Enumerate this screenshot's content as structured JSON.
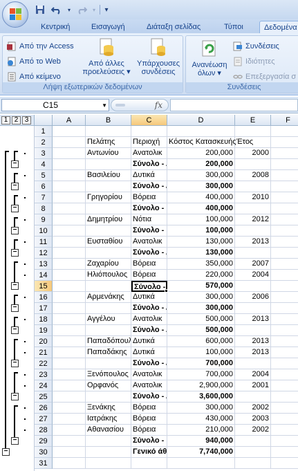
{
  "qat": {
    "save": "save-icon",
    "undo": "undo-icon",
    "redo": "redo-icon",
    "customize": "▾"
  },
  "tabs": [
    "Κεντρική",
    "Εισαγωγή",
    "Διάταξη σελίδας",
    "Τύποι",
    "Δεδομένα"
  ],
  "ribbon": {
    "external": {
      "access": "Από την Access",
      "web": "Από το Web",
      "text": "Από κείμενο",
      "other_line1": "Από άλλες",
      "other_line2": "προελεύσεις ▾",
      "existing_line1": "Υπάρχουσες",
      "existing_line2": "συνδέσεις",
      "label": "Λήψη εξωτερικών δεδομένων"
    },
    "connections": {
      "refresh_line1": "Ανανέωση",
      "refresh_line2": "όλων ▾",
      "conn": "Συνδέσεις",
      "props": "Ιδιότητες",
      "edit": "Επεξεργασία σ",
      "label": "Συνδέσεις"
    }
  },
  "formula_bar": {
    "name_box": "C15",
    "fx": "fx",
    "formula": ""
  },
  "outline_levels": [
    "1",
    "2",
    "3"
  ],
  "columns": [
    "A",
    "B",
    "C",
    "D",
    "E",
    "F"
  ],
  "rows": [
    {
      "n": "1",
      "b": "",
      "c": "",
      "d": "",
      "e": "",
      "bold": false
    },
    {
      "n": "2",
      "b": "Πελάτης",
      "c": "Περιοχή",
      "d": "Κόστος Κατασκευής",
      "e": "Έτος",
      "bold": false,
      "header": true
    },
    {
      "n": "3",
      "b": "Αντωνίου",
      "c": "Ανατολικ",
      "d": "200,000",
      "e": "2000",
      "bold": false
    },
    {
      "n": "4",
      "b": "",
      "c": "Σύνολο - Α",
      "d": "200,000",
      "e": "",
      "bold": true
    },
    {
      "n": "5",
      "b": "Βασιλείου",
      "c": "Δυτικά",
      "d": "300,000",
      "e": "2008",
      "bold": false
    },
    {
      "n": "6",
      "b": "",
      "c": "Σύνολο - Δ",
      "d": "300,000",
      "e": "",
      "bold": true
    },
    {
      "n": "7",
      "b": "Γρηγορίου",
      "c": "Βόρεια",
      "d": "400,000",
      "e": "2010",
      "bold": false
    },
    {
      "n": "8",
      "b": "",
      "c": "Σύνολο - Β",
      "d": "400,000",
      "e": "",
      "bold": true
    },
    {
      "n": "9",
      "b": "Δημητρίου",
      "c": "Νότια",
      "d": "100,000",
      "e": "2012",
      "bold": false
    },
    {
      "n": "10",
      "b": "",
      "c": "Σύνολο - Ν",
      "d": "100,000",
      "e": "",
      "bold": true
    },
    {
      "n": "11",
      "b": "Ευσταθίου",
      "c": "Ανατολικ",
      "d": "130,000",
      "e": "2013",
      "bold": false
    },
    {
      "n": "12",
      "b": "",
      "c": "Σύνολο - Α",
      "d": "130,000",
      "e": "",
      "bold": true
    },
    {
      "n": "13",
      "b": "Ζαχαρίου",
      "c": "Βόρεια",
      "d": "350,000",
      "e": "2007",
      "bold": false
    },
    {
      "n": "14",
      "b": "Ηλιόπουλος",
      "c": "Βόρεια",
      "d": "220,000",
      "e": "2004",
      "bold": false
    },
    {
      "n": "15",
      "b": "",
      "c": "Σύνολο - Β",
      "d": "570,000",
      "e": "",
      "bold": true
    },
    {
      "n": "16",
      "b": "Αρμενάκης",
      "c": "Δυτικά",
      "d": "300,000",
      "e": "2006",
      "bold": false
    },
    {
      "n": "17",
      "b": "",
      "c": "Σύνολο - Δ",
      "d": "300,000",
      "e": "",
      "bold": true
    },
    {
      "n": "18",
      "b": "Αγγέλου",
      "c": "Ανατολικ",
      "d": "500,000",
      "e": "2013",
      "bold": false
    },
    {
      "n": "19",
      "b": "",
      "c": "Σύνολο - Α",
      "d": "500,000",
      "e": "",
      "bold": true
    },
    {
      "n": "20",
      "b": "Παπαδόπουλ",
      "c": "Δυτικά",
      "d": "600,000",
      "e": "2013",
      "bold": false
    },
    {
      "n": "21",
      "b": "Παπαδάκης",
      "c": "Δυτικά",
      "d": "100,000",
      "e": "2013",
      "bold": false
    },
    {
      "n": "22",
      "b": "",
      "c": "Σύνολο - Δ",
      "d": "700,000",
      "e": "",
      "bold": true
    },
    {
      "n": "23",
      "b": "Ξενόπουλος",
      "c": "Ανατολικ",
      "d": "700,000",
      "e": "2004",
      "bold": false
    },
    {
      "n": "24",
      "b": "Ορφανός",
      "c": "Ανατολικ",
      "d": "2,900,000",
      "e": "2001",
      "bold": false
    },
    {
      "n": "25",
      "b": "",
      "c": "Σύνολο - Α",
      "d": "3,600,000",
      "e": "",
      "bold": true
    },
    {
      "n": "26",
      "b": "Ξενάκης",
      "c": "Βόρεια",
      "d": "300,000",
      "e": "2002",
      "bold": false
    },
    {
      "n": "27",
      "b": "Ιατράκης",
      "c": "Βόρεια",
      "d": "430,000",
      "e": "2003",
      "bold": false
    },
    {
      "n": "28",
      "b": "Αθανασίου",
      "c": "Βόρεια",
      "d": "210,000",
      "e": "2002",
      "bold": false
    },
    {
      "n": "29",
      "b": "",
      "c": "Σύνολο - Β",
      "d": "940,000",
      "e": "",
      "bold": true
    },
    {
      "n": "30",
      "b": "",
      "c": "Γενικό άθ",
      "d": "7,740,000",
      "e": "",
      "bold": true
    },
    {
      "n": "31",
      "b": "",
      "c": "",
      "d": "",
      "e": "",
      "bold": false
    }
  ],
  "selected_cell": "C15",
  "colors": {
    "accent": "#f6c87a",
    "ribbon": "#dbe7f6",
    "tab_text": "#15428b"
  }
}
